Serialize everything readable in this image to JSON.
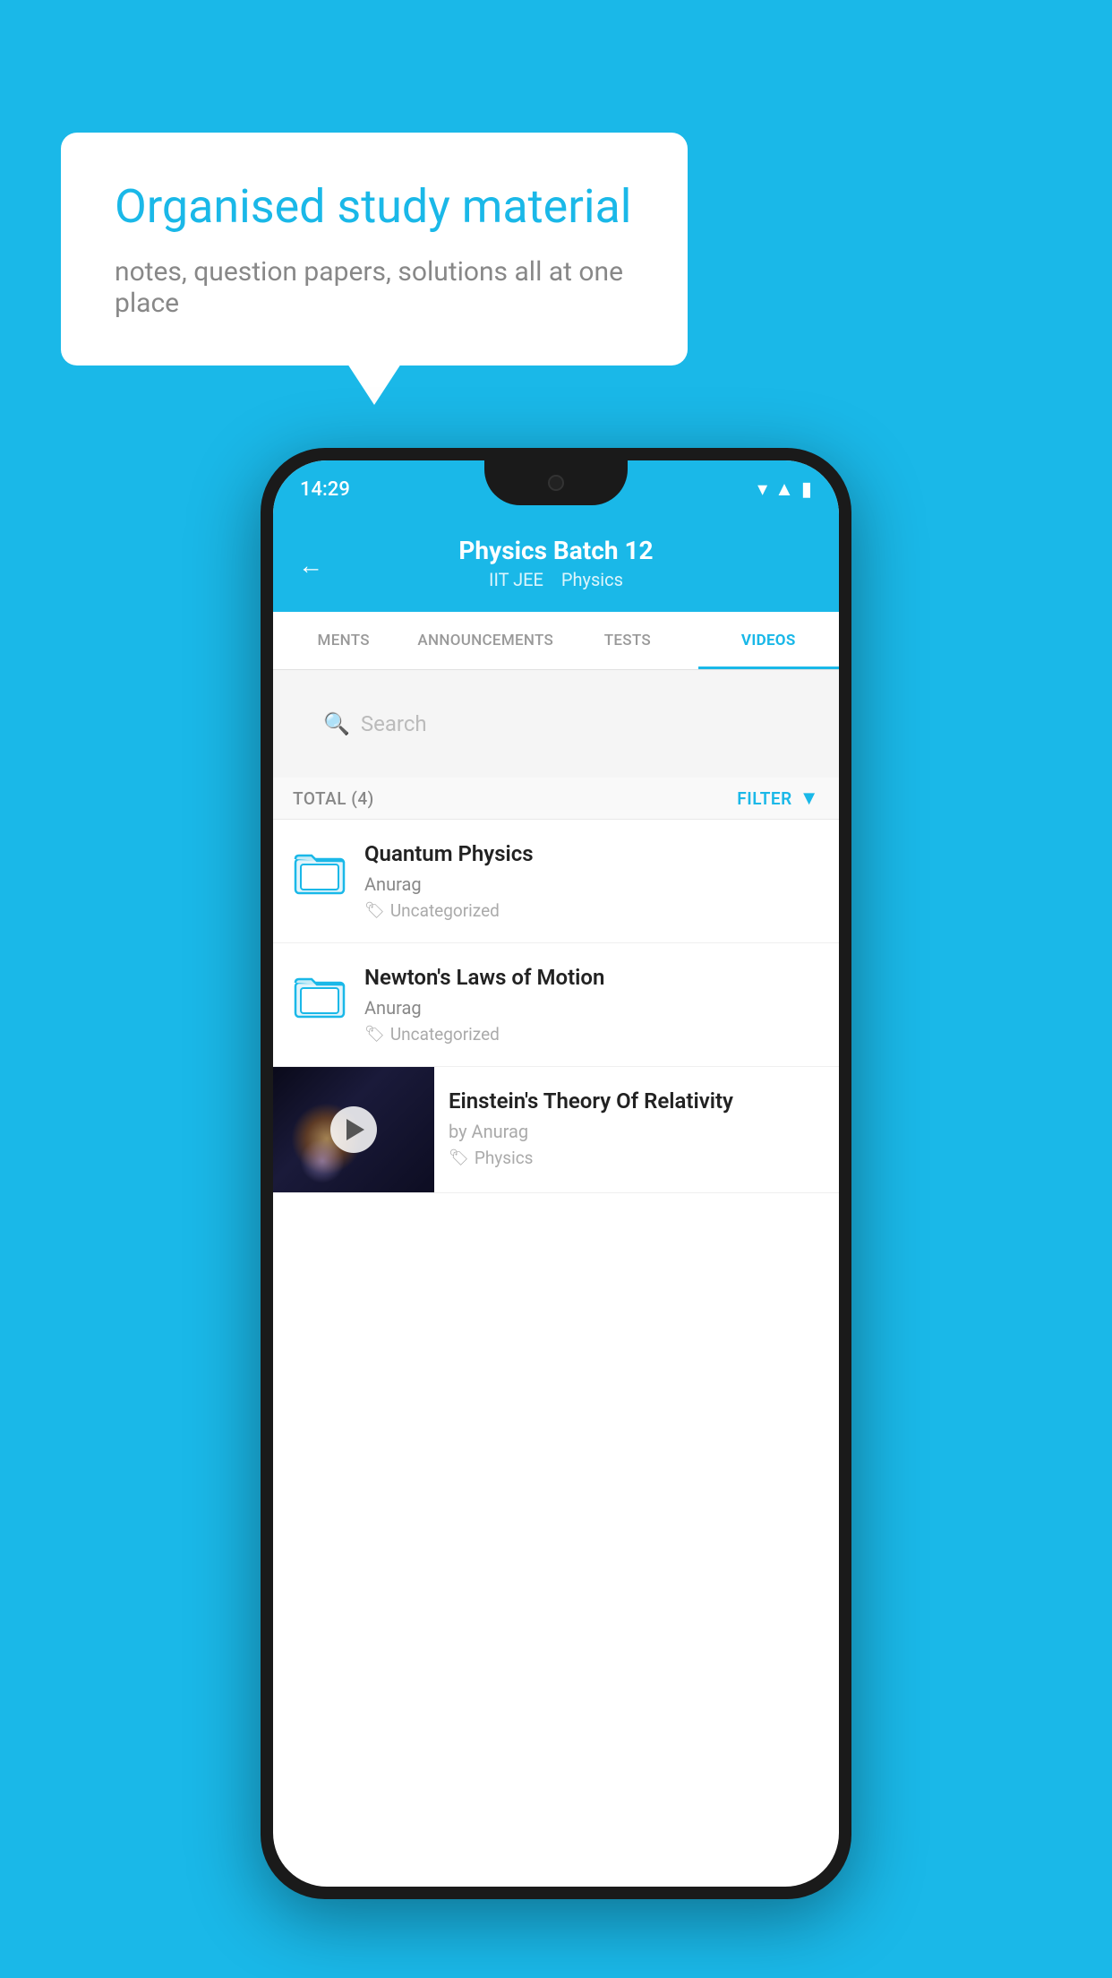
{
  "background_color": "#1ab8e8",
  "speech_bubble": {
    "title": "Organised study material",
    "subtitle": "notes, question papers, solutions all at one place"
  },
  "phone": {
    "status_bar": {
      "time": "14:29",
      "icons": [
        "wifi",
        "signal",
        "battery"
      ]
    },
    "header": {
      "title": "Physics Batch 12",
      "subtitle_left": "IIT JEE",
      "subtitle_right": "Physics",
      "back_label": "←"
    },
    "tabs": [
      {
        "label": "MENTS",
        "active": false
      },
      {
        "label": "ANNOUNCEMENTS",
        "active": false
      },
      {
        "label": "TESTS",
        "active": false
      },
      {
        "label": "VIDEOS",
        "active": true
      }
    ],
    "search": {
      "placeholder": "Search"
    },
    "list_header": {
      "total_label": "TOTAL (4)",
      "filter_label": "FILTER"
    },
    "videos": [
      {
        "title": "Quantum Physics",
        "author": "Anurag",
        "tag": "Uncategorized",
        "type": "folder"
      },
      {
        "title": "Newton's Laws of Motion",
        "author": "Anurag",
        "tag": "Uncategorized",
        "type": "folder"
      },
      {
        "title": "Einstein's Theory Of Relativity",
        "by_label": "by Anurag",
        "tag": "Physics",
        "type": "video"
      }
    ]
  }
}
